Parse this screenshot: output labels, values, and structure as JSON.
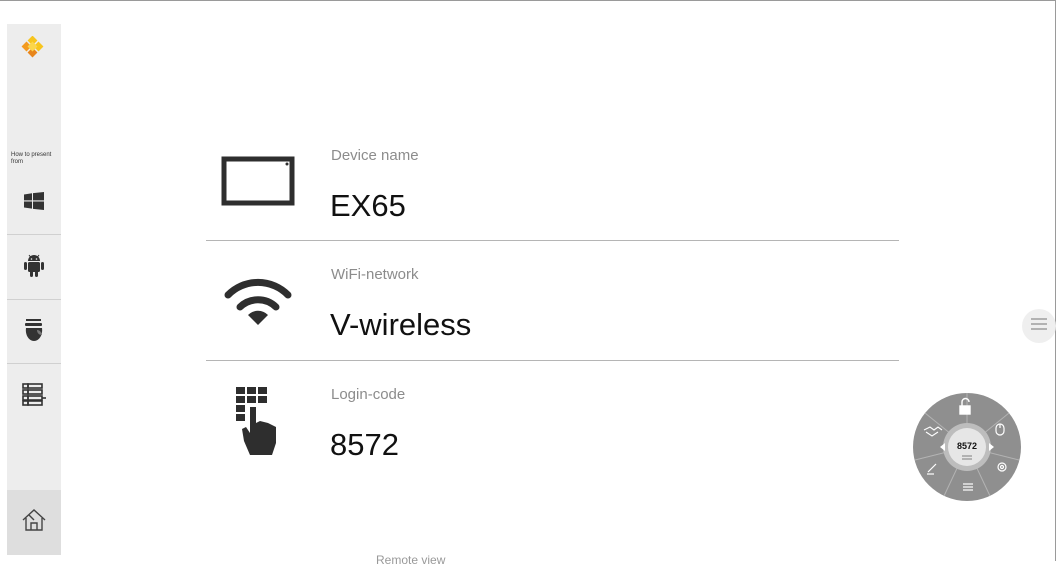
{
  "sidebar": {
    "logo_icon": "diamond-logo-icon",
    "present_label": "How to present from",
    "items": [
      {
        "icon": "windows-icon"
      },
      {
        "icon": "android-icon"
      },
      {
        "icon": "apple-icon"
      },
      {
        "icon": "list-settings-icon"
      }
    ],
    "home_icon": "home-icon"
  },
  "rows": [
    {
      "label": "Device name",
      "value": "EX65",
      "icon": "display-icon"
    },
    {
      "label": "WiFi-network",
      "value": "V-wireless",
      "icon": "wifi-icon"
    },
    {
      "label": "Login-code",
      "value": "8572",
      "icon": "keypad-hand-icon"
    }
  ],
  "remote_label": "Remote view",
  "radial_menu": {
    "center_code": "8572"
  },
  "colors": {
    "logo_orange": "#f39a1f",
    "logo_yellow": "#f7c51e",
    "sidebar_bg": "#ededed",
    "radial_bg": "#8f8f8f"
  }
}
